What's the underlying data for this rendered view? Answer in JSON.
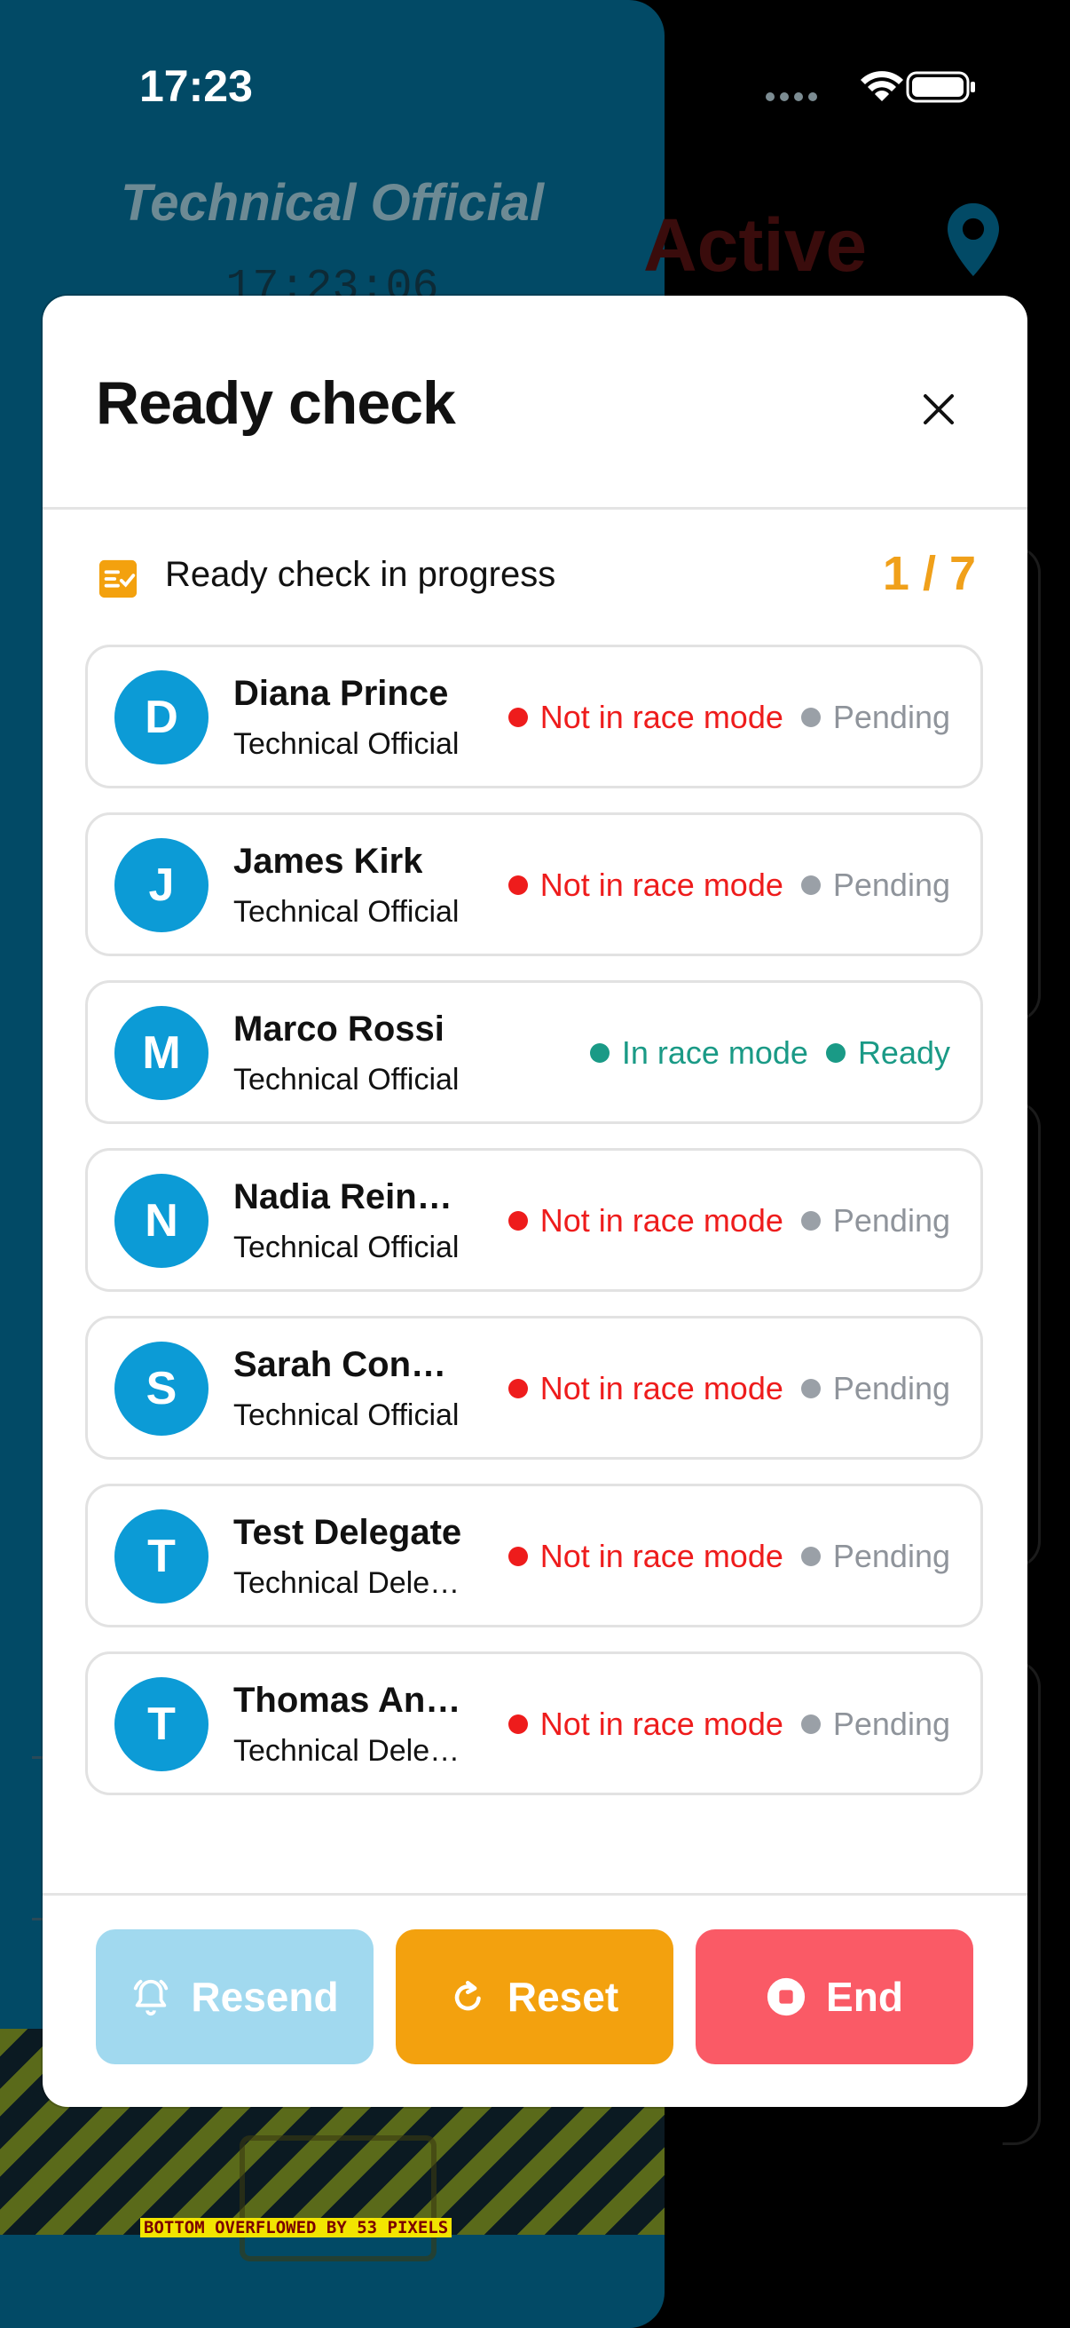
{
  "status_bar": {
    "time": "17:23"
  },
  "background": {
    "role_title": "Technical Official",
    "clock": "17:23:06",
    "status_word": "Active",
    "overflow_warning": "BOTTOM OVERFLOWED BY 53 PIXELS"
  },
  "modal": {
    "title": "Ready check",
    "progress_label": "Ready check in progress",
    "progress_count": "1 / 7",
    "participants": [
      {
        "initial": "D",
        "name": "Diana Prince",
        "role": "Technical Official",
        "mode": "Not in race mode",
        "state": "Pending"
      },
      {
        "initial": "J",
        "name": "James Kirk",
        "role": "Technical Official",
        "mode": "Not in race mode",
        "state": "Pending"
      },
      {
        "initial": "M",
        "name": "Marco Rossi",
        "role": "Technical Official",
        "mode": "In race mode",
        "state": "Ready"
      },
      {
        "initial": "N",
        "name": "Nadia Reinhardt",
        "role": "Technical Official",
        "mode": "Not in race mode",
        "state": "Pending"
      },
      {
        "initial": "S",
        "name": "Sarah Connor",
        "role": "Technical Official",
        "mode": "Not in race mode",
        "state": "Pending"
      },
      {
        "initial": "T",
        "name": "Test Delegate",
        "role": "Technical Delegate",
        "mode": "Not in race mode",
        "state": "Pending"
      },
      {
        "initial": "T",
        "name": "Thomas Anderson",
        "role": "Technical Delegate",
        "mode": "Not in race mode",
        "state": "Pending"
      }
    ],
    "buttons": {
      "resend": "Resend",
      "reset": "Reset",
      "end": "End"
    }
  },
  "colors": {
    "accent_orange": "#f3a10e",
    "avatar_blue": "#0c9bd6",
    "status_red": "#ee1c1c",
    "status_green": "#1a9a86",
    "status_grey": "#9aa0a7",
    "end_red": "#fa5a66",
    "resend_disabled": "#a1d9ef"
  },
  "icons": {
    "close": "close-icon",
    "progress": "checklist-icon",
    "resend": "bell-ring-icon",
    "reset": "refresh-icon",
    "end": "stop-circle-icon"
  }
}
